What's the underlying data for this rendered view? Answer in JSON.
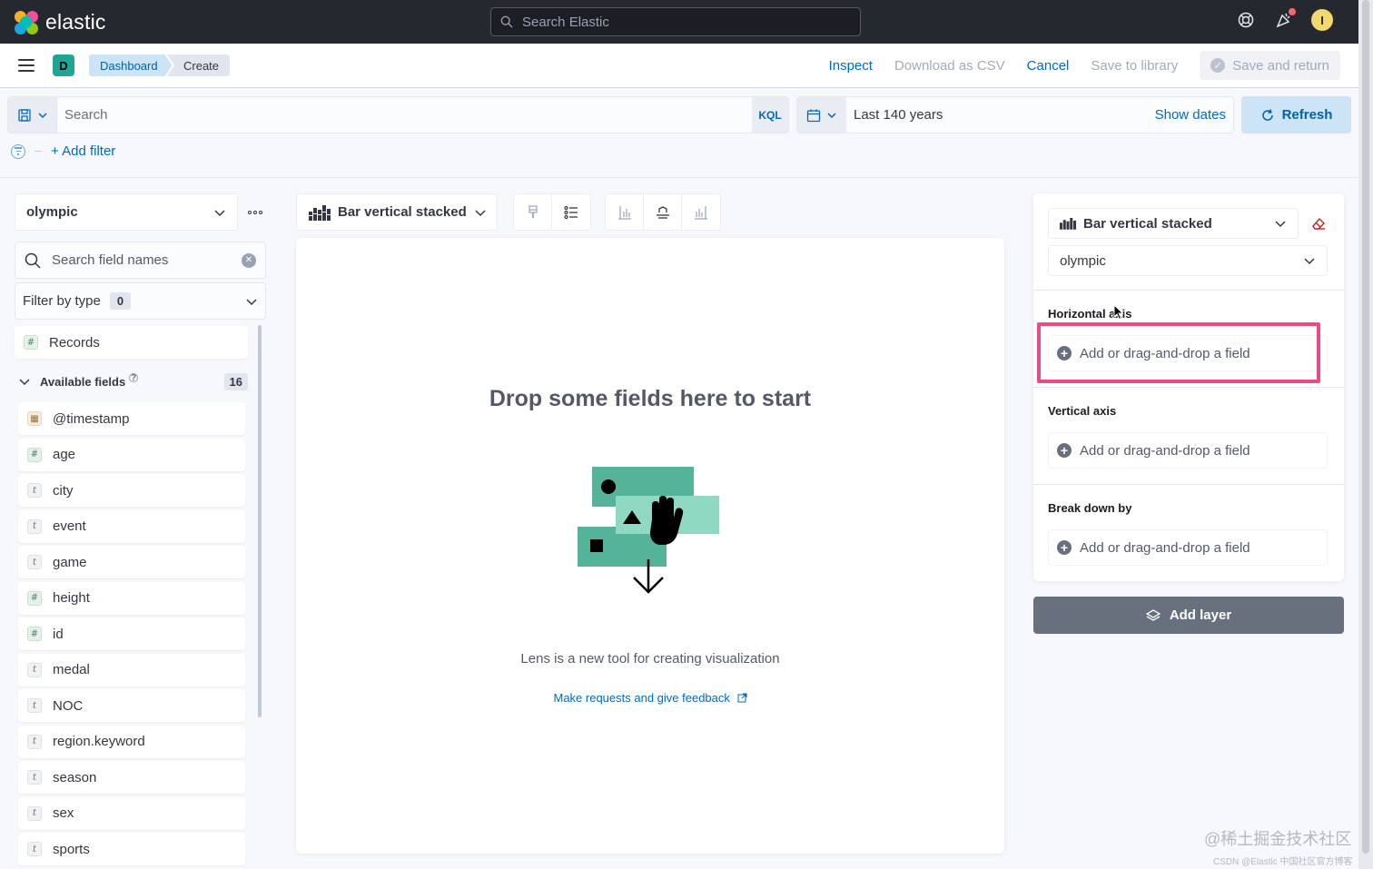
{
  "header": {
    "brand": "elastic",
    "global_search_placeholder": "Search Elastic",
    "avatar_initial": "I"
  },
  "nav": {
    "space_initial": "D",
    "breadcrumbs": [
      "Dashboard",
      "Create"
    ],
    "actions": {
      "inspect": "Inspect",
      "download_csv": "Download as CSV",
      "cancel": "Cancel",
      "save_to_library": "Save to library",
      "save_and_return": "Save and return"
    }
  },
  "query": {
    "placeholder": "Search",
    "language": "KQL",
    "time_range": "Last 140 years",
    "show_dates": "Show dates",
    "refresh": "Refresh",
    "add_filter": "+ Add filter"
  },
  "data_panel": {
    "index_pattern": "olympic",
    "field_search_placeholder": "Search field names",
    "filter_by_type": "Filter by type",
    "filter_count": "0",
    "records_label": "Records",
    "available_fields_label": "Available fields",
    "available_count": "16",
    "fields": [
      {
        "name": "@timestamp",
        "type": "date"
      },
      {
        "name": "age",
        "type": "number"
      },
      {
        "name": "city",
        "type": "string"
      },
      {
        "name": "event",
        "type": "string"
      },
      {
        "name": "game",
        "type": "string"
      },
      {
        "name": "height",
        "type": "number"
      },
      {
        "name": "id",
        "type": "number"
      },
      {
        "name": "medal",
        "type": "string"
      },
      {
        "name": "NOC",
        "type": "string"
      },
      {
        "name": "region.keyword",
        "type": "string"
      },
      {
        "name": "season",
        "type": "string"
      },
      {
        "name": "sex",
        "type": "string"
      },
      {
        "name": "sports",
        "type": "string"
      }
    ]
  },
  "workspace": {
    "chart_type": "Bar vertical stacked",
    "drop_title": "Drop some fields here to start",
    "description": "Lens is a new tool for creating visualization",
    "feedback_link": "Make requests and give feedback"
  },
  "config_panel": {
    "chart_type": "Bar vertical stacked",
    "index_pattern": "olympic",
    "dimensions": [
      {
        "label": "Horizontal axis",
        "button": "Add or drag-and-drop a field"
      },
      {
        "label": "Vertical axis",
        "button": "Add or drag-and-drop a field"
      },
      {
        "label": "Break down by",
        "button": "Add or drag-and-drop a field"
      }
    ],
    "add_layer": "Add layer"
  },
  "watermarks": {
    "line1": "@稀土掘金技术社区",
    "line2": "CSDN @Elastic 中国社区官方博客"
  },
  "colors": {
    "header_bg": "#25282f",
    "link": "#006bb8",
    "highlight": "#e74c86",
    "illustration_green": "#54b399"
  }
}
